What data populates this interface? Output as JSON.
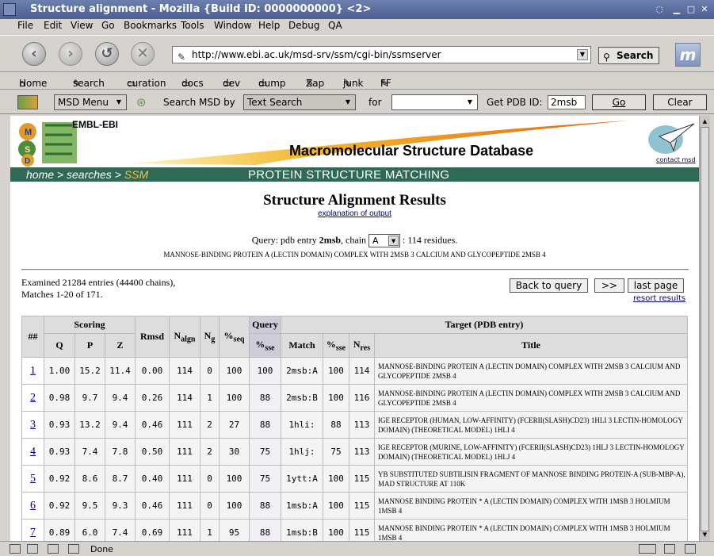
{
  "window": {
    "title": "Structure alignment - Mozilla {Build ID: 0000000000} <2>"
  },
  "menu": [
    "File",
    "Edit",
    "View",
    "Go",
    "Bookmarks",
    "Tools",
    "Window",
    "Help",
    "Debug",
    "QA"
  ],
  "nav": {
    "url": "http://www.ebi.ac.uk/msd-srv/ssm/cgi-bin/ssmserver",
    "search_label": "Search"
  },
  "bookmarks": [
    "Home",
    "search",
    "curation",
    "docs",
    "dev",
    "dump",
    "Zap",
    "junk",
    "FF"
  ],
  "msdbar": {
    "menu_label": "MSD Menu",
    "search_by_label": "Search MSD by",
    "search_by_value": "Text Search",
    "for_label": "for",
    "for_value": "",
    "pdb_label": "Get PDB ID:",
    "pdb_value": "2msb",
    "go_label": "Go",
    "clear_label": "Clear"
  },
  "banner": {
    "org": "EMBL-EBI",
    "title": "Macromolecular Structure Database",
    "contact": "contact msd",
    "crumb_home": "home",
    "crumb_searches": "searches",
    "crumb_ssm": "SSM",
    "sep": ">",
    "page_title": "PROTEIN STRUCTURE MATCHING",
    "logo": "MSD"
  },
  "results": {
    "heading": "Structure Alignment Results",
    "explanation": "explanation of output",
    "query_prefix": "Query: pdb entry",
    "query_entry": "2msb",
    "query_chain_label": ", chain",
    "query_chain": "A",
    "query_suffix": ": 114 residues.",
    "query_description": "MANNOSE-BINDING PROTEIN A (LECTIN DOMAIN) COMPLEX WITH 2MSB 3 CALCIUM AND GLYCOPEPTIDE 2MSB 4",
    "examined": "Examined 21284 entries (44400 chains),",
    "matches": "Matches 1-20 of 171.",
    "back_button": "Back to query",
    "next_button": ">>",
    "last_button": "last page",
    "resort": "resort results"
  },
  "table": {
    "headers": {
      "idx": "##",
      "scoring": "Scoring",
      "q": "Q",
      "p": "P",
      "z": "Z",
      "rmsd": "Rmsd",
      "nalgn": "N",
      "nalgn_sub": "algn",
      "ng": "N",
      "ng_sub": "g",
      "seq": "%",
      "seq_sub": "seq",
      "query": "Query",
      "sse": "%",
      "sse_sub": "sse",
      "target": "Target (PDB entry)",
      "match": "Match",
      "tsse": "%",
      "tsse_sub": "sse",
      "nres": "N",
      "nres_sub": "res",
      "title": "Title"
    },
    "rows": [
      {
        "idx": "1",
        "q": "1.00",
        "p": "15.2",
        "z": "11.4",
        "rmsd": "0.00",
        "nalgn": "114",
        "ng": "0",
        "seq": "100",
        "qsse": "100",
        "match": "2msb:A",
        "tsse": "100",
        "nres": "114",
        "title": "MANNOSE-BINDING PROTEIN A (LECTIN DOMAIN) COMPLEX WITH 2MSB 3 CALCIUM AND GLYCOPEPTIDE 2MSB 4"
      },
      {
        "idx": "2",
        "q": "0.98",
        "p": "9.7",
        "z": "9.4",
        "rmsd": "0.26",
        "nalgn": "114",
        "ng": "1",
        "seq": "100",
        "qsse": "88",
        "match": "2msb:B",
        "tsse": "100",
        "nres": "116",
        "title": "MANNOSE-BINDING PROTEIN A (LECTIN DOMAIN) COMPLEX WITH 2MSB 3 CALCIUM AND GLYCOPEPTIDE 2MSB 4"
      },
      {
        "idx": "3",
        "q": "0.93",
        "p": "13.2",
        "z": "9.4",
        "rmsd": "0.46",
        "nalgn": "111",
        "ng": "2",
        "seq": "27",
        "qsse": "88",
        "match": "1hli:",
        "tsse": "88",
        "nres": "113",
        "title": "IGE RECEPTOR (HUMAN, LOW-AFFINITY) (FCERII(SLASH)CD23) 1HLI 3 LECTIN-HOMOLOGY DOMAIN) (THEORETICAL MODEL) 1HLI 4"
      },
      {
        "idx": "4",
        "q": "0.93",
        "p": "7.4",
        "z": "7.8",
        "rmsd": "0.50",
        "nalgn": "111",
        "ng": "2",
        "seq": "30",
        "qsse": "75",
        "match": "1hlj:",
        "tsse": "75",
        "nres": "113",
        "title": "IGE RECEPTOR (MURINE, LOW-AFFINITY) (FCERII(SLASH)CD23) 1HLJ 3 LECTIN-HOMOLOGY DOMAIN) (THEORETICAL MODEL) 1HLJ 4"
      },
      {
        "idx": "5",
        "q": "0.92",
        "p": "8.6",
        "z": "8.7",
        "rmsd": "0.40",
        "nalgn": "111",
        "ng": "0",
        "seq": "100",
        "qsse": "75",
        "match": "1ytt:A",
        "tsse": "100",
        "nres": "115",
        "title": "YB SUBSTITUTED SUBTILISIN FRAGMENT OF MANNOSE BINDING PROTEIN-A (SUB-MBP-A), MAD STRUCTURE AT 110K"
      },
      {
        "idx": "6",
        "q": "0.92",
        "p": "9.5",
        "z": "9.3",
        "rmsd": "0.46",
        "nalgn": "111",
        "ng": "0",
        "seq": "100",
        "qsse": "88",
        "match": "1msb:A",
        "tsse": "100",
        "nres": "115",
        "title": "MANNOSE BINDING PROTEIN * A (LECTIN DOMAIN) COMPLEX WITH 1MSB 3 HOLMIUM 1MSB 4"
      },
      {
        "idx": "7",
        "q": "0.89",
        "p": "6.0",
        "z": "7.4",
        "rmsd": "0.69",
        "nalgn": "111",
        "ng": "1",
        "seq": "95",
        "qsse": "88",
        "match": "1msb:B",
        "tsse": "100",
        "nres": "115",
        "title": "MANNOSE BINDING PROTEIN * A (LECTIN DOMAIN) COMPLEX WITH 1MSB 3 HOLMIUM 1MSB 4"
      }
    ]
  },
  "status": {
    "text": "Done"
  }
}
